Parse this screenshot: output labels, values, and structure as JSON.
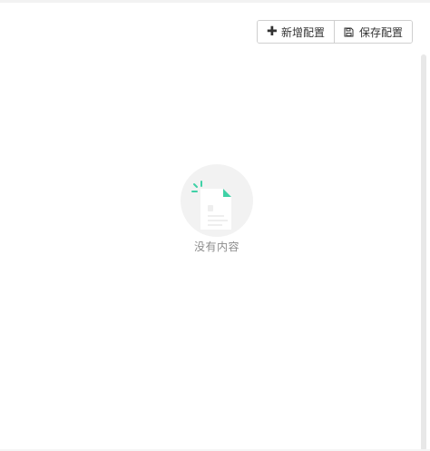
{
  "toolbar": {
    "add_label": "新增配置",
    "add_icon": "plus-icon",
    "save_label": "保存配置",
    "save_icon": "floppy-disk-icon"
  },
  "empty_state": {
    "text": "没有内容",
    "icon": "empty-document-illustration",
    "accent_color": "#3fd1a6"
  }
}
